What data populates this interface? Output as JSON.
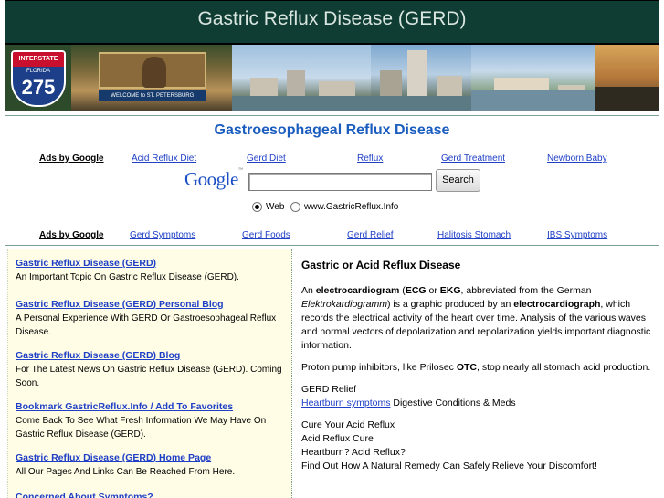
{
  "header": {
    "title": "Gastric Reflux Disease (GERD)"
  },
  "banner": {
    "shield_label": "INTERSTATE",
    "shield_state": "FLORIDA",
    "shield_number": "275",
    "sign_text": "WELCOME to ST. PETERSBURG"
  },
  "page_title": "Gastroesophageal Reflux Disease",
  "ads_row1": {
    "label": "Ads by Google",
    "links": [
      "Acid Reflux Diet",
      "Gerd Diet",
      "Reflux",
      "Gerd Treatment",
      "Newborn Baby"
    ]
  },
  "search": {
    "logo": "Google",
    "button_label": "Search",
    "option_web": "Web",
    "option_site": "www.GastricReflux.Info"
  },
  "ads_row2": {
    "label": "Ads by Google",
    "links": [
      "Gerd Symptoms",
      "Gerd Foods",
      "Gerd Relief",
      "Halitosis Stomach",
      "IBS Symptoms"
    ]
  },
  "left": {
    "items": [
      {
        "link": "Gastric Reflux Disease (GERD) ",
        "desc": "An Important Topic On Gastric Reflux Disease (GERD)."
      },
      {
        "link": "Gastric Reflux Disease (GERD) Personal Blog ",
        "desc": "A Personal Experience With GERD Or Gastroesophageal Reflux Disease."
      },
      {
        "link": "Gastric Reflux Disease (GERD) Blog ",
        "desc": "For The Latest News On Gastric Reflux Disease (GERD). Coming Soon."
      },
      {
        "link": "Bookmark GastricReflux.Info / Add To Favorites ",
        "desc": "Come Back To See What Fresh Information We May Have On Gastric Reflux Disease (GERD)."
      },
      {
        "link": "Gastric Reflux Disease (GERD) Home Page",
        "desc": "All Our Pages And Links Can Be Reached From Here."
      },
      {
        "link": "Concerned About Symptoms? ",
        "desc": ""
      }
    ]
  },
  "right": {
    "heading": "Gastric or Acid Reflux Disease",
    "p1": {
      "t1": "An ",
      "b1": "electrocardiogram",
      "t2": " (",
      "b2": "ECG",
      "t3": " or ",
      "b3": "EKG",
      "t4": ", abbreviated from the German ",
      "i1": "Elektrokardiogramm",
      "t5": ") is a graphic produced by an ",
      "b4": "electrocardiograph",
      "t6": ", which records the electrical activity of the heart over time. Analysis of the various waves and normal vectors of depolarization and repolarization yields important diagnostic information."
    },
    "p2": {
      "t1": "Proton pump inhibitors, like Prilosec ",
      "b1": "OTC",
      "t2": ", stop nearly all stomach acid production."
    },
    "relief": {
      "line1": "GERD Relief",
      "link": "Heartburn symptoms",
      "rest": " Digestive Conditions & Meds"
    },
    "cure": [
      "Cure Your Acid Reflux",
      "Acid Reflux Cure",
      "Heartburn? Acid Reflux?",
      "Find Out How A Natural Remedy Can Safely Relieve Your Discomfort!"
    ]
  }
}
